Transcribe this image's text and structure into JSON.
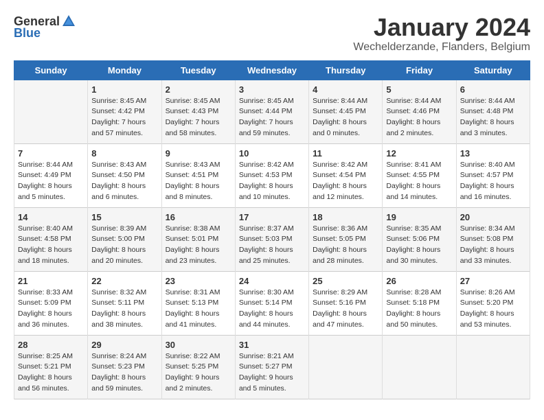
{
  "logo": {
    "general": "General",
    "blue": "Blue"
  },
  "title": "January 2024",
  "subtitle": "Wechelderzande, Flanders, Belgium",
  "days_of_week": [
    "Sunday",
    "Monday",
    "Tuesday",
    "Wednesday",
    "Thursday",
    "Friday",
    "Saturday"
  ],
  "weeks": [
    [
      {
        "day": "",
        "info": ""
      },
      {
        "day": "1",
        "info": "Sunrise: 8:45 AM\nSunset: 4:42 PM\nDaylight: 7 hours\nand 57 minutes."
      },
      {
        "day": "2",
        "info": "Sunrise: 8:45 AM\nSunset: 4:43 PM\nDaylight: 7 hours\nand 58 minutes."
      },
      {
        "day": "3",
        "info": "Sunrise: 8:45 AM\nSunset: 4:44 PM\nDaylight: 7 hours\nand 59 minutes."
      },
      {
        "day": "4",
        "info": "Sunrise: 8:44 AM\nSunset: 4:45 PM\nDaylight: 8 hours\nand 0 minutes."
      },
      {
        "day": "5",
        "info": "Sunrise: 8:44 AM\nSunset: 4:46 PM\nDaylight: 8 hours\nand 2 minutes."
      },
      {
        "day": "6",
        "info": "Sunrise: 8:44 AM\nSunset: 4:48 PM\nDaylight: 8 hours\nand 3 minutes."
      }
    ],
    [
      {
        "day": "7",
        "info": "Sunrise: 8:44 AM\nSunset: 4:49 PM\nDaylight: 8 hours\nand 5 minutes."
      },
      {
        "day": "8",
        "info": "Sunrise: 8:43 AM\nSunset: 4:50 PM\nDaylight: 8 hours\nand 6 minutes."
      },
      {
        "day": "9",
        "info": "Sunrise: 8:43 AM\nSunset: 4:51 PM\nDaylight: 8 hours\nand 8 minutes."
      },
      {
        "day": "10",
        "info": "Sunrise: 8:42 AM\nSunset: 4:53 PM\nDaylight: 8 hours\nand 10 minutes."
      },
      {
        "day": "11",
        "info": "Sunrise: 8:42 AM\nSunset: 4:54 PM\nDaylight: 8 hours\nand 12 minutes."
      },
      {
        "day": "12",
        "info": "Sunrise: 8:41 AM\nSunset: 4:55 PM\nDaylight: 8 hours\nand 14 minutes."
      },
      {
        "day": "13",
        "info": "Sunrise: 8:40 AM\nSunset: 4:57 PM\nDaylight: 8 hours\nand 16 minutes."
      }
    ],
    [
      {
        "day": "14",
        "info": "Sunrise: 8:40 AM\nSunset: 4:58 PM\nDaylight: 8 hours\nand 18 minutes."
      },
      {
        "day": "15",
        "info": "Sunrise: 8:39 AM\nSunset: 5:00 PM\nDaylight: 8 hours\nand 20 minutes."
      },
      {
        "day": "16",
        "info": "Sunrise: 8:38 AM\nSunset: 5:01 PM\nDaylight: 8 hours\nand 23 minutes."
      },
      {
        "day": "17",
        "info": "Sunrise: 8:37 AM\nSunset: 5:03 PM\nDaylight: 8 hours\nand 25 minutes."
      },
      {
        "day": "18",
        "info": "Sunrise: 8:36 AM\nSunset: 5:05 PM\nDaylight: 8 hours\nand 28 minutes."
      },
      {
        "day": "19",
        "info": "Sunrise: 8:35 AM\nSunset: 5:06 PM\nDaylight: 8 hours\nand 30 minutes."
      },
      {
        "day": "20",
        "info": "Sunrise: 8:34 AM\nSunset: 5:08 PM\nDaylight: 8 hours\nand 33 minutes."
      }
    ],
    [
      {
        "day": "21",
        "info": "Sunrise: 8:33 AM\nSunset: 5:09 PM\nDaylight: 8 hours\nand 36 minutes."
      },
      {
        "day": "22",
        "info": "Sunrise: 8:32 AM\nSunset: 5:11 PM\nDaylight: 8 hours\nand 38 minutes."
      },
      {
        "day": "23",
        "info": "Sunrise: 8:31 AM\nSunset: 5:13 PM\nDaylight: 8 hours\nand 41 minutes."
      },
      {
        "day": "24",
        "info": "Sunrise: 8:30 AM\nSunset: 5:14 PM\nDaylight: 8 hours\nand 44 minutes."
      },
      {
        "day": "25",
        "info": "Sunrise: 8:29 AM\nSunset: 5:16 PM\nDaylight: 8 hours\nand 47 minutes."
      },
      {
        "day": "26",
        "info": "Sunrise: 8:28 AM\nSunset: 5:18 PM\nDaylight: 8 hours\nand 50 minutes."
      },
      {
        "day": "27",
        "info": "Sunrise: 8:26 AM\nSunset: 5:20 PM\nDaylight: 8 hours\nand 53 minutes."
      }
    ],
    [
      {
        "day": "28",
        "info": "Sunrise: 8:25 AM\nSunset: 5:21 PM\nDaylight: 8 hours\nand 56 minutes."
      },
      {
        "day": "29",
        "info": "Sunrise: 8:24 AM\nSunset: 5:23 PM\nDaylight: 8 hours\nand 59 minutes."
      },
      {
        "day": "30",
        "info": "Sunrise: 8:22 AM\nSunset: 5:25 PM\nDaylight: 9 hours\nand 2 minutes."
      },
      {
        "day": "31",
        "info": "Sunrise: 8:21 AM\nSunset: 5:27 PM\nDaylight: 9 hours\nand 5 minutes."
      },
      {
        "day": "",
        "info": ""
      },
      {
        "day": "",
        "info": ""
      },
      {
        "day": "",
        "info": ""
      }
    ]
  ]
}
